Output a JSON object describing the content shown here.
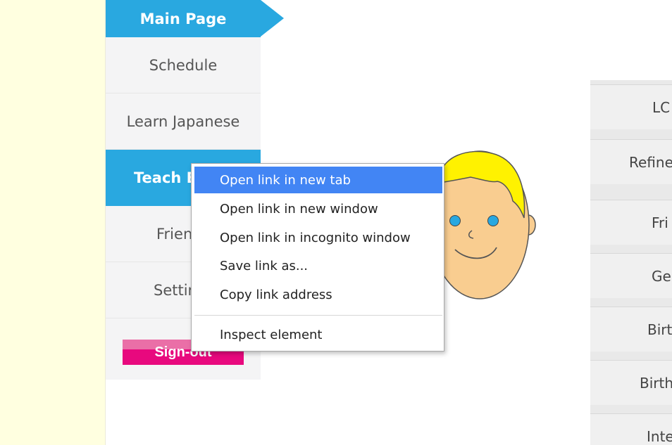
{
  "sidebar": {
    "items": [
      {
        "label": "Main Page",
        "active": true
      },
      {
        "label": "Schedule",
        "active": false
      },
      {
        "label": "Learn Japanese",
        "active": false
      },
      {
        "label": "Teach E",
        "active": true
      },
      {
        "label": "Frien",
        "active": false
      },
      {
        "label": "Settir",
        "active": false
      }
    ],
    "signout_label": "Sign-out"
  },
  "right_menu": {
    "items": [
      "LC",
      "Refine",
      "Fri",
      "Ge",
      "Birt",
      "Birth",
      "Inte"
    ]
  },
  "context_menu": {
    "items": [
      {
        "label": "Open link in new tab",
        "highlighted": true
      },
      {
        "label": "Open link in new window",
        "highlighted": false
      },
      {
        "label": "Open link in incognito window",
        "highlighted": false
      },
      {
        "label": "Save link as...",
        "highlighted": false
      },
      {
        "label": "Copy link address",
        "highlighted": false
      },
      {
        "label": "Inspect element",
        "highlighted": false
      }
    ]
  },
  "colors": {
    "accent": "#29a8e0",
    "signout": "#e8097e",
    "menu_highlight": "#4285f4",
    "background_strip": "#ffffe0"
  },
  "icons": {
    "avatar": "cartoon-face-avatar"
  }
}
